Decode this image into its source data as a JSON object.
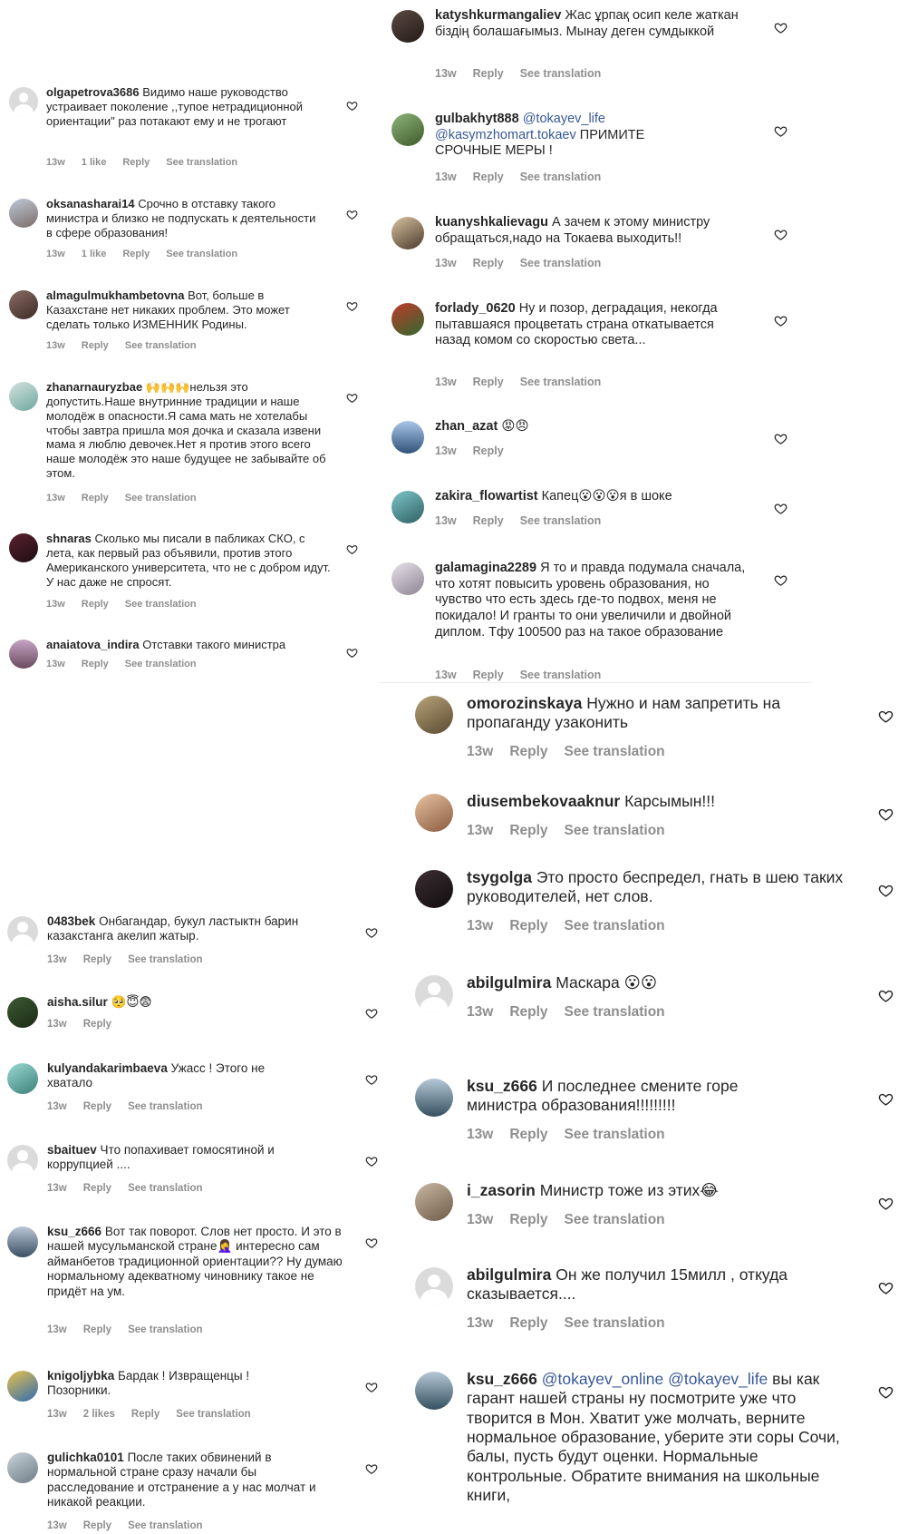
{
  "ui": {
    "reply_label": "Reply",
    "see_translation_label": "See translation"
  },
  "colors": {
    "text": "#262626",
    "muted": "#8e8e8e",
    "mention": "#385898",
    "divider": "#efefef"
  },
  "top_left": [
    {
      "user": "olgapetrova3686",
      "text": "Видимо наше руководство устраивает поколение ,,тупое нетрадиционной ориентации\" раз потакают ему и не трогают",
      "time": "13w",
      "likes": "1 like"
    },
    {
      "user": "oksanasharai14",
      "text": "Срочно в отставку такого министра и близко не подпускать к деятельности в сфере образования!",
      "time": "13w",
      "likes": "1 like"
    },
    {
      "user": "almagulmukhambetovna",
      "text": "Вот, больше в Казахстане нет никаких проблем. Это может сделать только ИЗМЕННИК Родины.",
      "time": "13w"
    },
    {
      "user": "zhanarnauryzbae",
      "text": "🙌🙌🙌нельзя это допустить.Наше внутринние традиции и наше молодёж в опасности.Я сама мать не хотелабы чтобы завтра пришла моя дочка и сказала извени мама я люблю девочек.Нет я против этого всего наше молодёж это наше будущее не забывайте об этом.",
      "time": "13w"
    },
    {
      "user": "shnaras",
      "text": "Сколько мы писали в пабликах СКО, с лета, как первый раз объявили, против этого Американского университета, что не с добром идут. У нас даже не спросят.",
      "time": "13w"
    },
    {
      "user": "anaiatova_indira",
      "text": "Отставки такого министра",
      "time": "13w"
    }
  ],
  "top_right": [
    {
      "user": "katyshkurmangaliev",
      "text": "Жас ұрпақ осип келе жаткан біздің болашағымыз. Мынау деген сумдыккой",
      "time": "13w"
    },
    {
      "user": "gulbakhyt888",
      "mention1": "@tokayev_life",
      "mention2": "@kasymzhomart.tokaev",
      "text": "ПРИМИТЕ СРОЧНЫЕ МЕРЫ !",
      "time": "13w"
    },
    {
      "user": "kuanyshkalievagu",
      "text": "А зачем к этому министру обращаться,надо на Токаева выходить!!",
      "time": "13w"
    },
    {
      "user": "forlady_0620",
      "text": "Ну и позор, деградация, некогда пытавшаяся процветать страна откатывается назад комом со скоростью света...",
      "time": "13w"
    },
    {
      "user": "zhan_azat",
      "text": "😡😠",
      "time": "13w"
    },
    {
      "user": "zakira_flowartist",
      "text": "Капец😮😮😮я в шоке",
      "time": "13w"
    },
    {
      "user": "galamagina2289",
      "text": "Я то и правда подумала сначала, что хотят повысить уровень образования, но чувство что есть здесь где-то подвох, меня не покидало! И гранты то они увеличили и двойной диплом. Тфу 100500 раз на такое образование",
      "time": "13w"
    }
  ],
  "bottom_left": [
    {
      "user": "0483bek",
      "text": "Онбагандар, букул ластыктн барин казакстанга акелип жатыр.",
      "time": "13w"
    },
    {
      "user": "aisha.silur",
      "text": "🥺😇😨",
      "time": "13w"
    },
    {
      "user": "kulyandakarimbaeva",
      "text": "Ужасс ! Этого не хватало",
      "time": "13w"
    },
    {
      "user": "sbaituev",
      "text": "Что попахивает гомосятиной и коррупцией ....",
      "time": "13w"
    },
    {
      "user": "ksu_z666",
      "text": "Вот так поворот. Слов нет просто. И это в нашей мусульманской стране🤦‍♀️ интересно сам айманбетов традиционной ориентации?? Ну думаю нормальному адекватному чиновнику такое не придёт на ум.",
      "time": "13w"
    },
    {
      "user": "knigoljybka",
      "text": "Бардак ! Извращенцы ! Позорники.",
      "time": "13w",
      "likes": "2 likes"
    },
    {
      "user": "gulichka0101",
      "text": "После таких обвинений в нормальной стране сразу начали бы расследование и отстранение а у нас молчат и никакой реакции.",
      "time": "13w"
    }
  ],
  "bottom_right": [
    {
      "user": "omorozinskaya",
      "text": "Нужно и нам запретить на пропаганду узаконить",
      "time": "13w"
    },
    {
      "user": "diusembekovaaknur",
      "text": "Карсымын!!!",
      "time": "13w"
    },
    {
      "user": "tsygolga",
      "text": "Это просто беспредел, гнать в шею таких руководителей, нет слов.",
      "time": "13w"
    },
    {
      "user": "abilgulmira",
      "text": "Маскара 😮😮",
      "time": "13w"
    },
    {
      "user": "ksu_z666",
      "text": "И последнее  смените горе министра образования!!!!!!!!!",
      "time": "13w"
    },
    {
      "user": "i_zasorin",
      "text": "Министр тоже из этих😂",
      "time": "13w"
    },
    {
      "user": "abilgulmira",
      "text": "Он же получил 15милл , откуда сказывается....",
      "time": "13w"
    },
    {
      "user": "ksu_z666",
      "mention1": "@tokayev_online",
      "mention2": "@tokayev_life",
      "text": "вы как гарант нашей страны ну посмотрите уже что творится в Мон. Хватит уже молчать, верните нормальное образование, уберите эти соры Сочи, балы, пусть будут оценки. Нормальные контрольные. Обратите внимания на школьные книги,"
    }
  ]
}
